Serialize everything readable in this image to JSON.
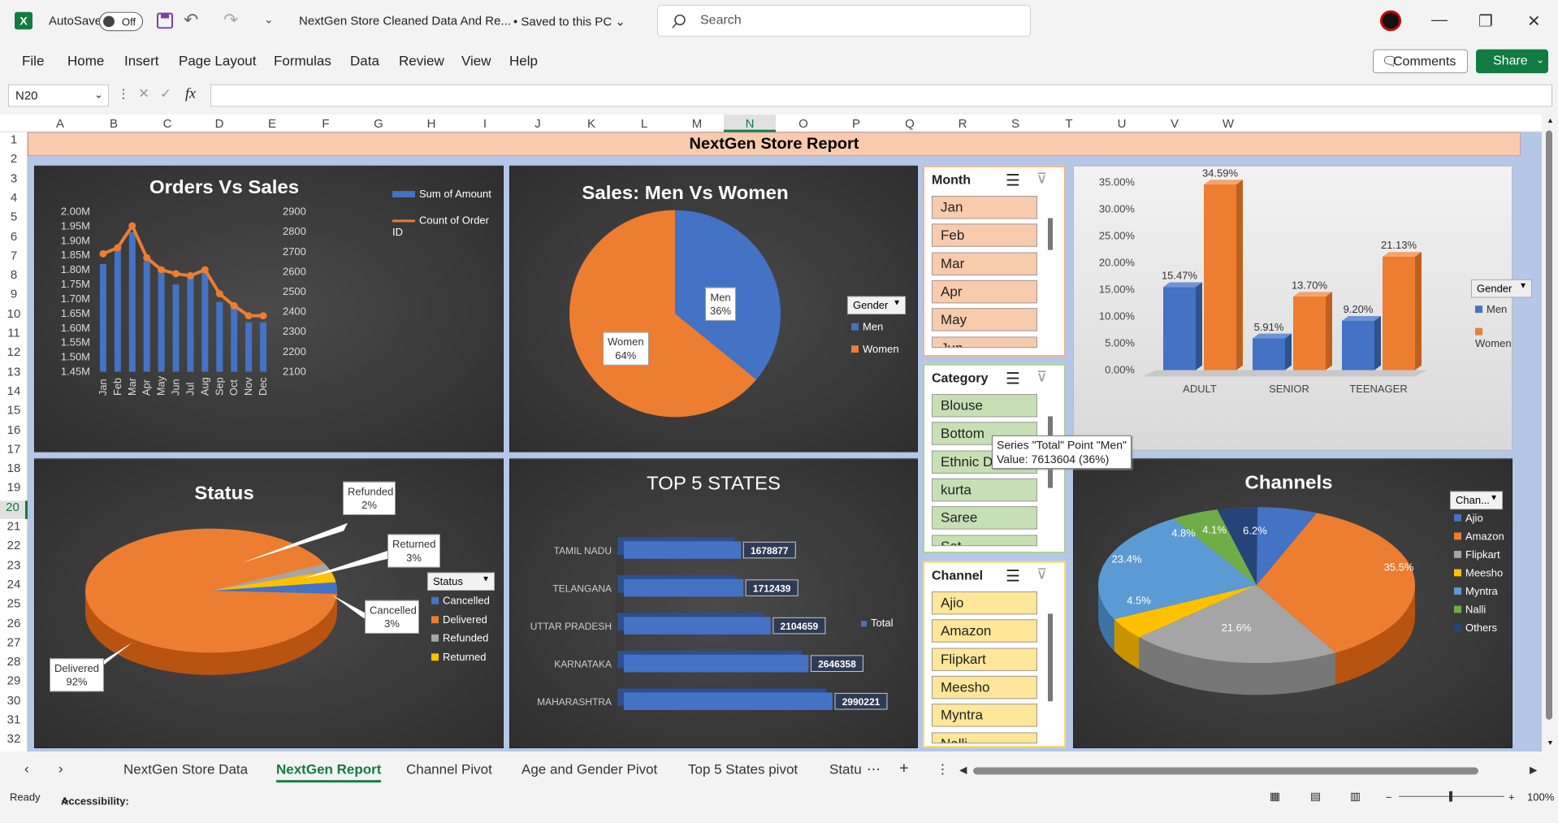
{
  "titlebar": {
    "autosave_label": "AutoSave",
    "autosave_state": "Off",
    "doc_title": "NextGen Store Cleaned Data And Re...",
    "save_status": "Saved to this PC",
    "search_placeholder": "Search"
  },
  "menu": [
    "File",
    "Home",
    "Insert",
    "Page Layout",
    "Formulas",
    "Data",
    "Review",
    "View",
    "Help"
  ],
  "buttons": {
    "comments": "Comments",
    "share": "Share"
  },
  "formula": {
    "namebox": "N20",
    "fx": "fx",
    "value": ""
  },
  "columns": [
    "A",
    "B",
    "C",
    "D",
    "E",
    "F",
    "G",
    "H",
    "I",
    "J",
    "K",
    "L",
    "M",
    "N",
    "O",
    "P",
    "Q",
    "R",
    "S",
    "T",
    "U",
    "V",
    "W"
  ],
  "rows": [
    "1",
    "2",
    "3",
    "4",
    "5",
    "6",
    "7",
    "8",
    "9",
    "10",
    "11",
    "12",
    "13",
    "14",
    "15",
    "16",
    "17",
    "18",
    "19",
    "20",
    "21",
    "22",
    "23",
    "24",
    "25",
    "26",
    "27",
    "28",
    "29",
    "30",
    "31",
    "32"
  ],
  "selected": {
    "col": "N",
    "row": "20"
  },
  "banner": "NextGen Store Report",
  "orders_chart": {
    "title": "Orders Vs Sales",
    "legend_bar": "Sum of Amount",
    "legend_line": "Count of Order ID",
    "left_ticks": [
      "2.00M",
      "1.95M",
      "1.90M",
      "1.85M",
      "1.80M",
      "1.75M",
      "1.70M",
      "1.65M",
      "1.60M",
      "1.55M",
      "1.50M",
      "1.45M"
    ],
    "right_ticks": [
      "2900",
      "2800",
      "2700",
      "2600",
      "2500",
      "2400",
      "2300",
      "2200",
      "2100"
    ]
  },
  "gender_pie": {
    "title": "Sales: Men Vs Women",
    "legend_title": "Gender",
    "men_label": "Men",
    "men_pct": "36%",
    "women_label": "Women",
    "women_pct": "64%"
  },
  "tooltip": {
    "line1": "Series \"Total\" Point \"Men\"",
    "line2": "Value: 7613604 (36%)"
  },
  "age_chart": {
    "legend_title": "Gender",
    "ticks": [
      "35.00%",
      "30.00%",
      "25.00%",
      "20.00%",
      "15.00%",
      "10.00%",
      "5.00%",
      "0.00%"
    ],
    "labels": {
      "adult_men": "15.47%",
      "adult_women": "34.59%",
      "senior_men": "5.91%",
      "senior_women": "13.70%",
      "teen_men": "9.20%",
      "teen_women": "21.13%"
    }
  },
  "status_chart": {
    "title": "Status",
    "legend_title": "Status",
    "callouts": {
      "refunded": [
        "Refunded",
        "2%"
      ],
      "returned": [
        "Returned",
        "3%"
      ],
      "cancelled": [
        "Cancelled",
        "3%"
      ],
      "delivered": [
        "Delivered",
        "92%"
      ]
    }
  },
  "states_chart": {
    "title": "TOP 5 STATES",
    "legend": "Total"
  },
  "channels_chart": {
    "title": "Channels",
    "legend_title": "Chan...",
    "slice_labels": {
      "amazon": "35.5%",
      "flipkart": "21.6%",
      "meesho": "4.5%",
      "myntra": "23.4%",
      "nalli": "4.8%",
      "others": "4.1%",
      "ajio": "6.2%"
    }
  },
  "chart_data": [
    {
      "type": "bar",
      "title": "Orders Vs Sales",
      "categories": [
        "Jan",
        "Feb",
        "Mar",
        "Apr",
        "May",
        "Jun",
        "Jul",
        "Aug",
        "Sep",
        "Oct",
        "Nov",
        "Dec"
      ],
      "series": [
        {
          "name": "Sum of Amount",
          "type": "bar",
          "values": [
            1.82,
            1.88,
            1.93,
            1.83,
            1.8,
            1.75,
            1.79,
            1.8,
            1.69,
            1.67,
            1.62,
            1.62
          ],
          "ylim": [
            1.45,
            2.0
          ]
        },
        {
          "name": "Count of Order ID",
          "type": "line",
          "values": [
            2690,
            2720,
            2830,
            2670,
            2610,
            2590,
            2580,
            2610,
            2490,
            2430,
            2380,
            2380
          ],
          "ylim": [
            2100,
            2900
          ]
        }
      ]
    },
    {
      "type": "pie",
      "title": "Sales: Men Vs Women",
      "categories": [
        "Men",
        "Women"
      ],
      "values": [
        36,
        64
      ]
    },
    {
      "type": "bar",
      "categories": [
        "ADULT",
        "SENIOR",
        "TEENAGER"
      ],
      "series": [
        {
          "name": "Men",
          "values": [
            15.47,
            5.91,
            9.2
          ]
        },
        {
          "name": "Women",
          "values": [
            34.59,
            13.7,
            21.13
          ]
        }
      ],
      "ylim": [
        0,
        35
      ]
    },
    {
      "type": "pie",
      "title": "Status",
      "categories": [
        "Cancelled",
        "Delivered",
        "Refunded",
        "Returned"
      ],
      "values": [
        3,
        92,
        2,
        3
      ]
    },
    {
      "type": "bar",
      "title": "TOP 5 STATES",
      "categories": [
        "TAMIL NADU",
        "TELANGANA",
        "UTTAR PRADESH",
        "KARNATAKA",
        "MAHARASHTRA"
      ],
      "series": [
        {
          "name": "Total",
          "values": [
            1678877,
            1712439,
            2104659,
            2646358,
            2990221
          ]
        }
      ]
    },
    {
      "type": "pie",
      "title": "Channels",
      "categories": [
        "Ajio",
        "Amazon",
        "Flipkart",
        "Meesho",
        "Myntra",
        "Nalli",
        "Others"
      ],
      "values": [
        6.2,
        35.5,
        21.6,
        4.5,
        23.4,
        4.8,
        4.1
      ]
    }
  ],
  "slicers": {
    "month": {
      "title": "Month",
      "items": [
        "Jan",
        "Feb",
        "Mar",
        "Apr",
        "May",
        "Jun"
      ]
    },
    "category": {
      "title": "Category",
      "items": [
        "Blouse",
        "Bottom",
        "Ethnic D",
        "kurta",
        "Saree",
        "Set"
      ]
    },
    "channel": {
      "title": "Channel",
      "items": [
        "Ajio",
        "Amazon",
        "Flipkart",
        "Meesho",
        "Myntra",
        "Nalli"
      ]
    }
  },
  "tabs": [
    "NextGen Store Data",
    "NextGen Report",
    "Channel Pivot",
    "Age and Gender Pivot",
    "Top 5 States pivot",
    "Statu"
  ],
  "active_tab": "NextGen Report",
  "status": {
    "ready": "Ready",
    "accessibility": "Accessibility: Investigate",
    "zoom": "100%"
  },
  "colors": {
    "excel_green": "#107c41",
    "men": "#4472c4",
    "women": "#ed7d31",
    "gray": "#a5a5a5",
    "gold": "#ffc000",
    "lightblue": "#5b9bd5",
    "green": "#70ad47",
    "navy": "#264478"
  }
}
